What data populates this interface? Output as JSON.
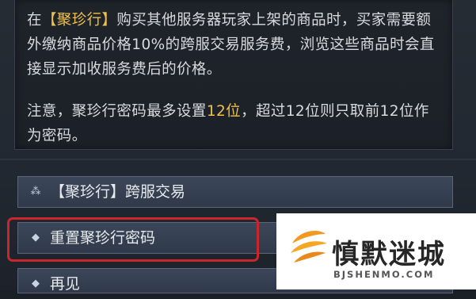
{
  "info_text": {
    "p1_before": "在",
    "p1_highlight": "【聚珍行】",
    "p1_after": "购买其他服务器玩家上架的商品时，买家需要额外缴纳商品价格10%的跨服交易服务费，浏览这些商品时会直接显示加收服务费后的价格。",
    "p2_before": "注意，聚珍行密码最多设置",
    "p2_highlight": "12位",
    "p2_after": "，超过12位则只取前12位作为密码。"
  },
  "options": [
    {
      "label": "【聚珍行】跨服交易",
      "icon": "cluster-icon"
    },
    {
      "label": "重置聚珍行密码",
      "icon": "diamond-icon"
    },
    {
      "label": "再见",
      "icon": "diamond-icon"
    }
  ],
  "watermark": {
    "title": "慎默迷城",
    "subtitle": "BJSHENMO.COM"
  },
  "colors": {
    "highlight": "#f0c14a",
    "selection_outline": "#c8262b",
    "logo_orange": "#f29a1f"
  }
}
